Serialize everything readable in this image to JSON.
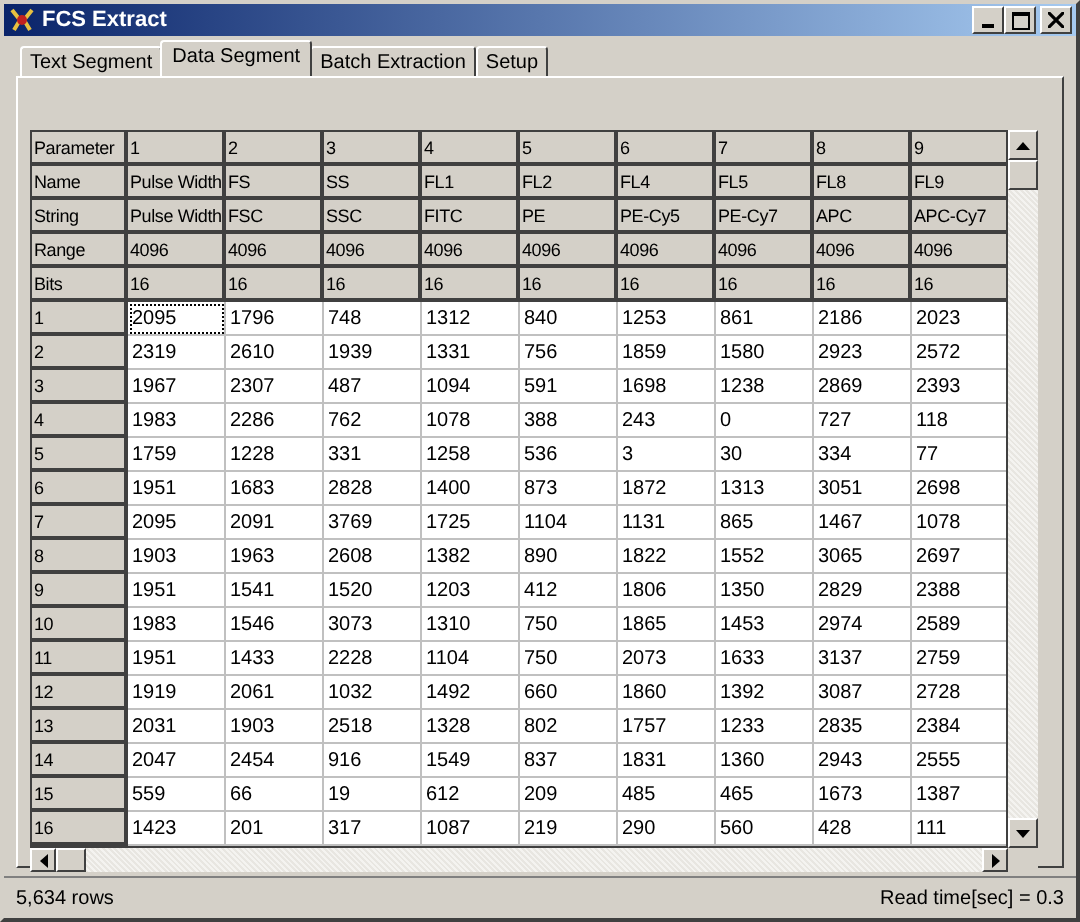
{
  "window": {
    "title": "FCS Extract"
  },
  "tabs": [
    {
      "label": "Text Segment",
      "selected": false
    },
    {
      "label": "Data Segment",
      "selected": true
    },
    {
      "label": "Batch Extraction",
      "selected": false
    },
    {
      "label": "Setup",
      "selected": false
    }
  ],
  "table": {
    "header_rows": [
      {
        "label": "Parameter",
        "cells": [
          "1",
          "2",
          "3",
          "4",
          "5",
          "6",
          "7",
          "8",
          "9"
        ]
      },
      {
        "label": "Name",
        "cells": [
          "Pulse Width",
          "FS",
          "SS",
          "FL1",
          "FL2",
          "FL4",
          "FL5",
          "FL8",
          "FL9"
        ]
      },
      {
        "label": "String",
        "cells": [
          "Pulse Width",
          "FSC",
          "SSC",
          "FITC",
          "PE",
          "PE-Cy5",
          "PE-Cy7",
          "APC",
          "APC-Cy7"
        ]
      },
      {
        "label": "Range",
        "cells": [
          "4096",
          "4096",
          "4096",
          "4096",
          "4096",
          "4096",
          "4096",
          "4096",
          "4096"
        ]
      },
      {
        "label": "Bits",
        "cells": [
          "16",
          "16",
          "16",
          "16",
          "16",
          "16",
          "16",
          "16",
          "16"
        ]
      }
    ],
    "rows": [
      {
        "label": "1",
        "focused": true,
        "cells": [
          "2095",
          "1796",
          "748",
          "1312",
          "840",
          "1253",
          "861",
          "2186",
          "2023"
        ]
      },
      {
        "label": "2",
        "focused": false,
        "cells": [
          "2319",
          "2610",
          "1939",
          "1331",
          "756",
          "1859",
          "1580",
          "2923",
          "2572"
        ]
      },
      {
        "label": "3",
        "focused": false,
        "cells": [
          "1967",
          "2307",
          "487",
          "1094",
          "591",
          "1698",
          "1238",
          "2869",
          "2393"
        ]
      },
      {
        "label": "4",
        "focused": false,
        "cells": [
          "1983",
          "2286",
          "762",
          "1078",
          "388",
          "243",
          "0",
          "727",
          "118"
        ]
      },
      {
        "label": "5",
        "focused": false,
        "cells": [
          "1759",
          "1228",
          "331",
          "1258",
          "536",
          "3",
          "30",
          "334",
          "77"
        ]
      },
      {
        "label": "6",
        "focused": false,
        "cells": [
          "1951",
          "1683",
          "2828",
          "1400",
          "873",
          "1872",
          "1313",
          "3051",
          "2698"
        ]
      },
      {
        "label": "7",
        "focused": false,
        "cells": [
          "2095",
          "2091",
          "3769",
          "1725",
          "1104",
          "1131",
          "865",
          "1467",
          "1078"
        ]
      },
      {
        "label": "8",
        "focused": false,
        "cells": [
          "1903",
          "1963",
          "2608",
          "1382",
          "890",
          "1822",
          "1552",
          "3065",
          "2697"
        ]
      },
      {
        "label": "9",
        "focused": false,
        "cells": [
          "1951",
          "1541",
          "1520",
          "1203",
          "412",
          "1806",
          "1350",
          "2829",
          "2388"
        ]
      },
      {
        "label": "10",
        "focused": false,
        "cells": [
          "1983",
          "1546",
          "3073",
          "1310",
          "750",
          "1865",
          "1453",
          "2974",
          "2589"
        ]
      },
      {
        "label": "11",
        "focused": false,
        "cells": [
          "1951",
          "1433",
          "2228",
          "1104",
          "750",
          "2073",
          "1633",
          "3137",
          "2759"
        ]
      },
      {
        "label": "12",
        "focused": false,
        "cells": [
          "1919",
          "2061",
          "1032",
          "1492",
          "660",
          "1860",
          "1392",
          "3087",
          "2728"
        ]
      },
      {
        "label": "13",
        "focused": false,
        "cells": [
          "2031",
          "1903",
          "2518",
          "1328",
          "802",
          "1757",
          "1233",
          "2835",
          "2384"
        ]
      },
      {
        "label": "14",
        "focused": false,
        "cells": [
          "2047",
          "2454",
          "916",
          "1549",
          "837",
          "1831",
          "1360",
          "2943",
          "2555"
        ]
      },
      {
        "label": "15",
        "focused": false,
        "cells": [
          "559",
          "66",
          "19",
          "612",
          "209",
          "485",
          "465",
          "1673",
          "1387"
        ]
      },
      {
        "label": "16",
        "focused": false,
        "cells": [
          "1423",
          "201",
          "317",
          "1087",
          "219",
          "290",
          "560",
          "428",
          "111"
        ]
      }
    ]
  },
  "status_bar": {
    "left": "5,634 rows",
    "right": "Read time[sec] = 0.3"
  }
}
